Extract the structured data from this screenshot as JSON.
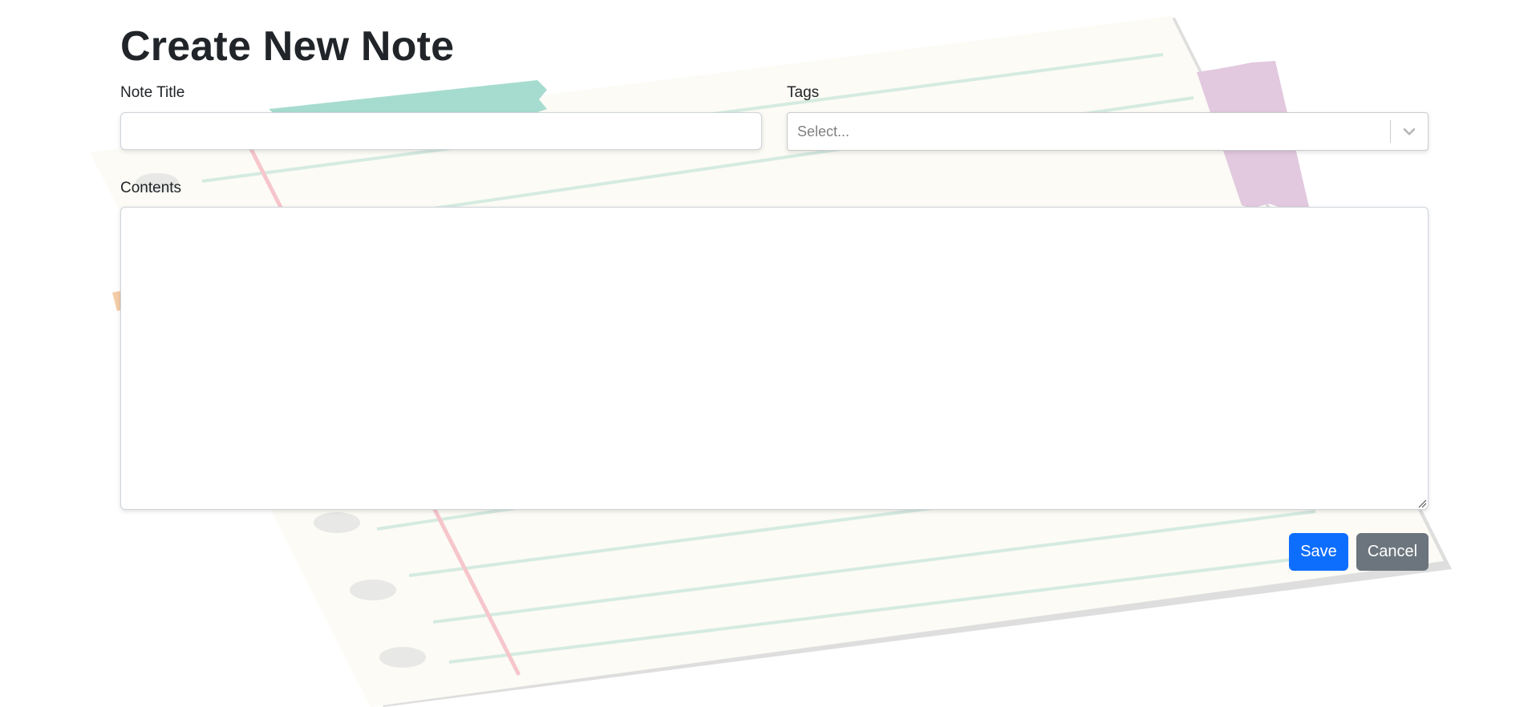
{
  "page": {
    "title": "Create New Note"
  },
  "form": {
    "title_label": "Note Title",
    "title_value": "",
    "tags_label": "Tags",
    "tags_placeholder": "Select...",
    "contents_label": "Contents",
    "contents_value": ""
  },
  "actions": {
    "save_label": "Save",
    "cancel_label": "Cancel"
  },
  "colors": {
    "primary": "#0d6efd",
    "secondary": "#6c757d",
    "paper": "#fcfbf5",
    "ruled_line": "#cfe9de",
    "margin_line": "#f6c6cc",
    "tape_teal": "#a6dccf",
    "tape_purple": "#e2c9df"
  },
  "icons": {
    "tags_dropdown": "chevron-down-icon",
    "textarea_resize": "resize-grip-icon"
  }
}
